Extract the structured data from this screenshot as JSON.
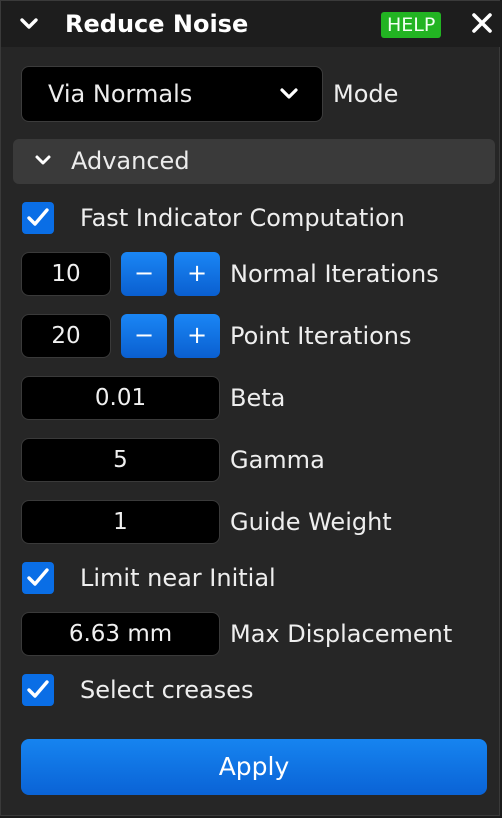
{
  "panel": {
    "title": "Reduce Noise",
    "help_label": "HELP",
    "colors": {
      "accent": "#0a6ee6",
      "help": "#22b422",
      "background": "#262626"
    }
  },
  "mode": {
    "value": "Via Normals",
    "label": "Mode"
  },
  "advanced": {
    "label": "Advanced"
  },
  "fast_indicator": {
    "label": "Fast Indicator Computation",
    "checked": true
  },
  "normal_iterations": {
    "value": "10",
    "label": "Normal Iterations",
    "minus": "−",
    "plus": "+"
  },
  "point_iterations": {
    "value": "20",
    "label": "Point Iterations",
    "minus": "−",
    "plus": "+"
  },
  "beta": {
    "value": "0.01",
    "label": "Beta"
  },
  "gamma": {
    "value": "5",
    "label": "Gamma"
  },
  "guide_weight": {
    "value": "1",
    "label": "Guide Weight"
  },
  "limit_near_initial": {
    "label": "Limit near Initial",
    "checked": true
  },
  "max_displacement": {
    "value": "6.63 mm",
    "label": "Max Displacement"
  },
  "select_creases": {
    "label": "Select creases",
    "checked": true
  },
  "apply_label": "Apply"
}
